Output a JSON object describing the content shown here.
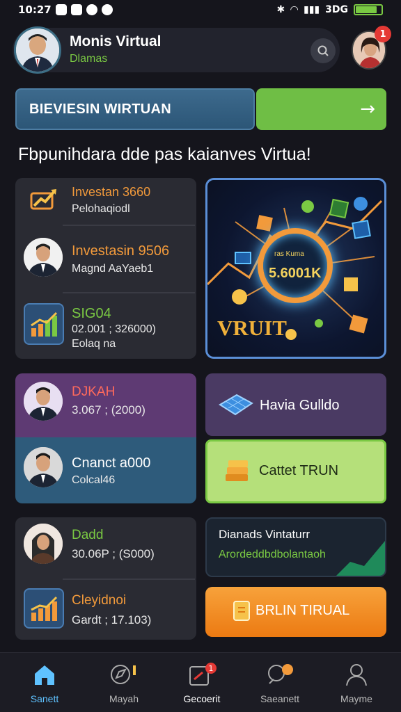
{
  "status": {
    "time": "10:27",
    "network": "3DG"
  },
  "header": {
    "name": "Monis Virtual",
    "subtitle": "Dlamas",
    "notif_count": "1"
  },
  "banner": {
    "label": "BIEVIESIN WIRTUAN",
    "arrow": "→"
  },
  "section_title": "Fbpunihdara dde pas kaianves Virtua!",
  "left_list_1": [
    {
      "title": "Investan 3660",
      "sub": "Pelohaqiodl",
      "title_color": "#f29a3b"
    },
    {
      "title": "Investasin 9506",
      "sub": "Magnd AaYaeb1",
      "title_color": "#f29a3b"
    },
    {
      "title": "SIG04",
      "sub": "02.001 ; 326000)",
      "sub2": "Eolaq na",
      "title_color": "#7ac943"
    }
  ],
  "promo_card": {
    "ring_small": "ras Kuma",
    "ring_big": "5.6001K",
    "brand": "VRUIT"
  },
  "left_list_2": [
    {
      "title": "DJKAH",
      "sub": "3.067 ; (2000)",
      "title_color": "#ff6a5c"
    },
    {
      "title": "Cnanct a000",
      "sub": "Colcal46",
      "title_color": "#ffffff"
    }
  ],
  "right_tiles": {
    "guide": "Havia Gulldo",
    "cta": "Cattet TRUN"
  },
  "left_list_3": [
    {
      "title": "Dadd",
      "sub": "30.06P ; (S000)",
      "title_color": "#7ac943"
    },
    {
      "title": "Cleyidnoi",
      "sub": "Gardt ; 17.103)",
      "title_color": "#f29a3b"
    }
  ],
  "dianas_card": {
    "title": "Dianads Vintaturr",
    "sub": "Arordeddbdbolantaoh"
  },
  "orange_button": "BRLIN TIRUAL",
  "nav": [
    {
      "label": "Sanett",
      "icon": "home-icon",
      "active": true
    },
    {
      "label": "Mayah",
      "icon": "compass-icon",
      "active": false
    },
    {
      "label": "Gecoerit",
      "icon": "wallet-icon",
      "active": false,
      "badge": "1"
    },
    {
      "label": "Saeanett",
      "icon": "chat-icon",
      "active": false
    },
    {
      "label": "Mayme",
      "icon": "profile-icon",
      "active": false
    }
  ]
}
